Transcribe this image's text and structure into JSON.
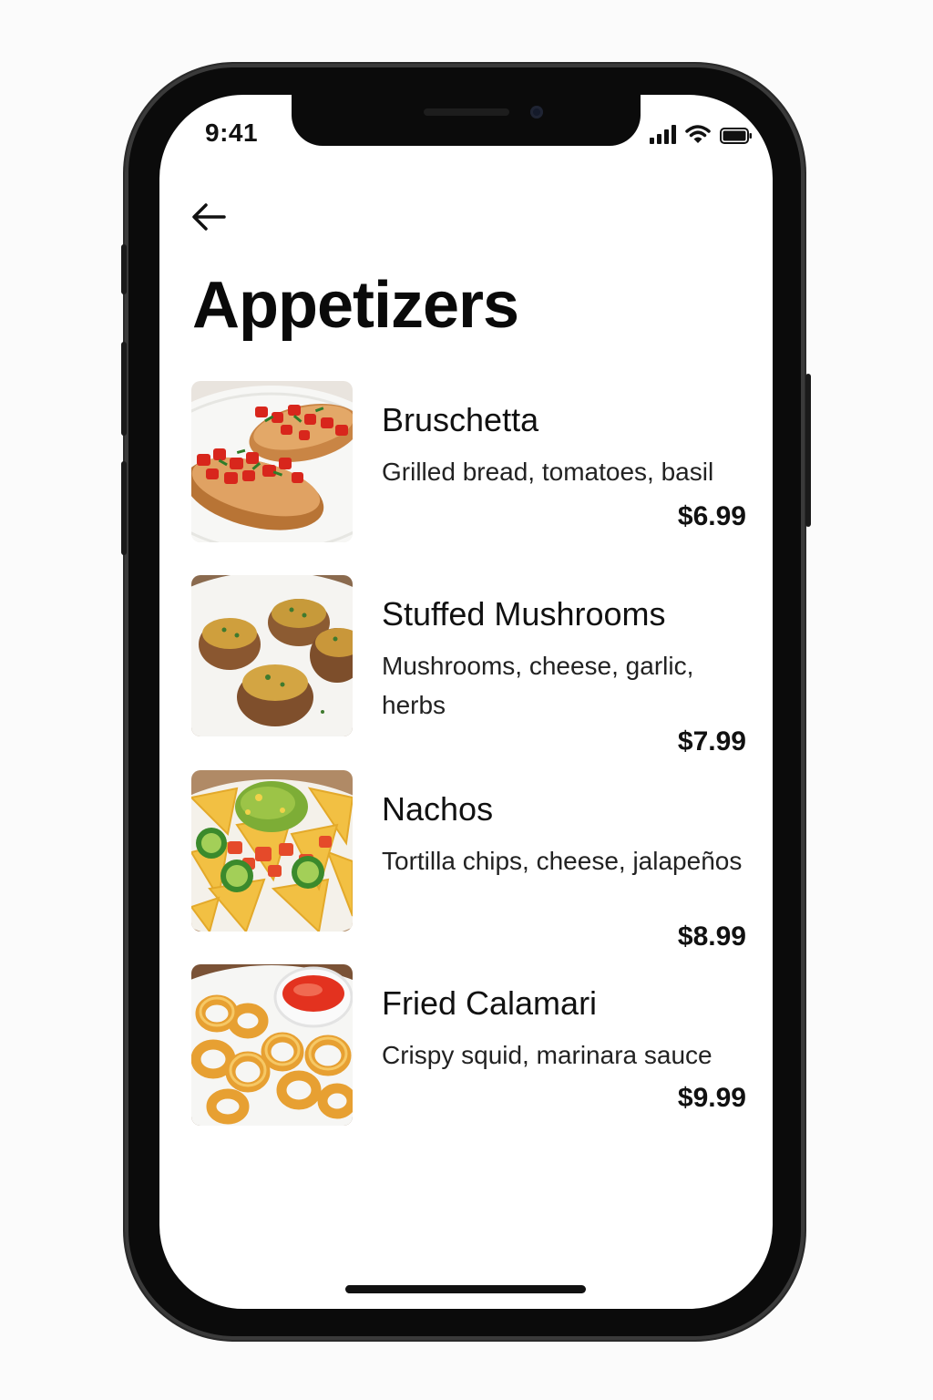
{
  "status_bar": {
    "time": "9:41"
  },
  "header": {
    "back_icon": "arrow-left-icon",
    "title": "Appetizers"
  },
  "menu_items": [
    {
      "name": "Bruschetta",
      "description": "Grilled bread, tomatoes, basil",
      "price": "$6.99",
      "image": "bruschetta"
    },
    {
      "name": "Stuffed Mushrooms",
      "description": "Mushrooms, cheese,  garlic, herbs",
      "price": "$7.99",
      "image": "stuffed-mushrooms"
    },
    {
      "name": "Nachos",
      "description": "Tortilla chips, cheese, jalapeños",
      "price": "$8.99",
      "image": "nachos"
    },
    {
      "name": "Fried Calamari",
      "description": "Crispy squid, marinara sauce",
      "price": "$9.99",
      "image": "fried-calamari"
    }
  ],
  "colors": {
    "background": "#ffffff",
    "text": "#111111",
    "frame": "#0b0b0b"
  }
}
